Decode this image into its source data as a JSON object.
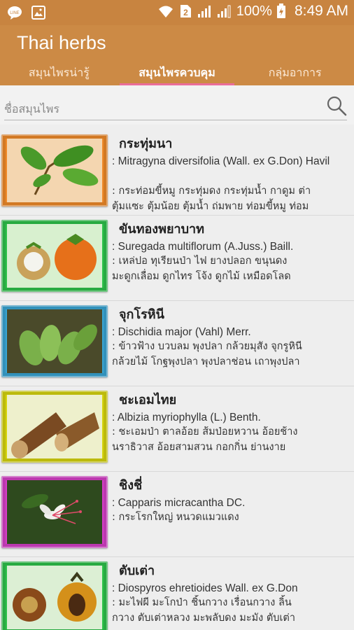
{
  "status_bar": {
    "sim": "2",
    "battery": "100%",
    "time": "8:49 AM"
  },
  "app": {
    "title": "Thai herbs"
  },
  "tabs": [
    {
      "label": "สมุนไพรน่ารู้"
    },
    {
      "label": "สมุนไพรควบคุม"
    },
    {
      "label": "กลุ่มอาการ"
    }
  ],
  "search": {
    "placeholder": "ชื่อสมุนไพร"
  },
  "colors": {
    "status_bar": "#c88440",
    "app_bar": "#cc8a45",
    "tab_indicator": "#ea6d9a"
  },
  "herbs": [
    {
      "name": "กระทุ่มนา",
      "scientific": ": Mitragyna  diversifolia (Wall. ex G.Don) Havil",
      "local_1": ": กระท่อมขี้หมู กระทุ่มดง กระทุ่มน้ำ กาดูม ต่า",
      "local_2": "ตุ้มแซะ ตุ้มน้อย ตุ้มน้ำ ถ่มพาย ท่อมขี้หมู ท่อม",
      "frame_color": "#f08a2a"
    },
    {
      "name": "ขันทองพยาบาท",
      "scientific": ": Suregada   multiflorum (A.Juss.) Baill.",
      "local_1": ": เหล่ปอ ทุเรียนป่า ไฟ ยางปลอก ขนุนดง",
      "local_2": "มะดูกเลื่อม ดูกไทร โจ้ง ดูกไม้  เหมือดโลด",
      "frame_color": "#2ec24a"
    },
    {
      "name": "จุกโรหินี",
      "scientific": ": Dischidia  major  (Vahl) Merr.",
      "local_1": ": ข้าวฟ้าง บวบลม พุงปลา กล้วยมุสัง จุกรูหินี",
      "local_2": "กล้วยไม้ โกฐพุงปลา พุงปลาช่อน เถาพุงปลา",
      "frame_color": "#3aa6d4"
    },
    {
      "name": "ชะเอมไทย",
      "scientific": ": Albizia  myriophylla (L.) Benth.",
      "local_1": ": ชะเอมป่า ตาลอ้อย ส้มป่อยหวาน อ้อยช้าง",
      "local_2": "นราธิวาส อ้อยสามสวน กอกกิ่น ย่านงาย",
      "frame_color": "#d6d40e"
    },
    {
      "name": "ชิงชี่",
      "scientific": ": Capparis micracantha DC.",
      "local_1": ": กระโรกใหญ่ หนวดแมวแดง",
      "local_2": "",
      "frame_color": "#d640c8"
    },
    {
      "name": "ตับเต่า",
      "scientific": ": Diospyros  ehretioides Wall. ex G.Don",
      "local_1": ": มะไฟผี มะโกป่า ชิ้นกวาง เรื่อนกวาง ลิ้น",
      "local_2": "กวาง ตับเต่าหลวง มะพลับดง มะมัง ตับเต่า",
      "frame_color": "#2ec24a"
    }
  ]
}
